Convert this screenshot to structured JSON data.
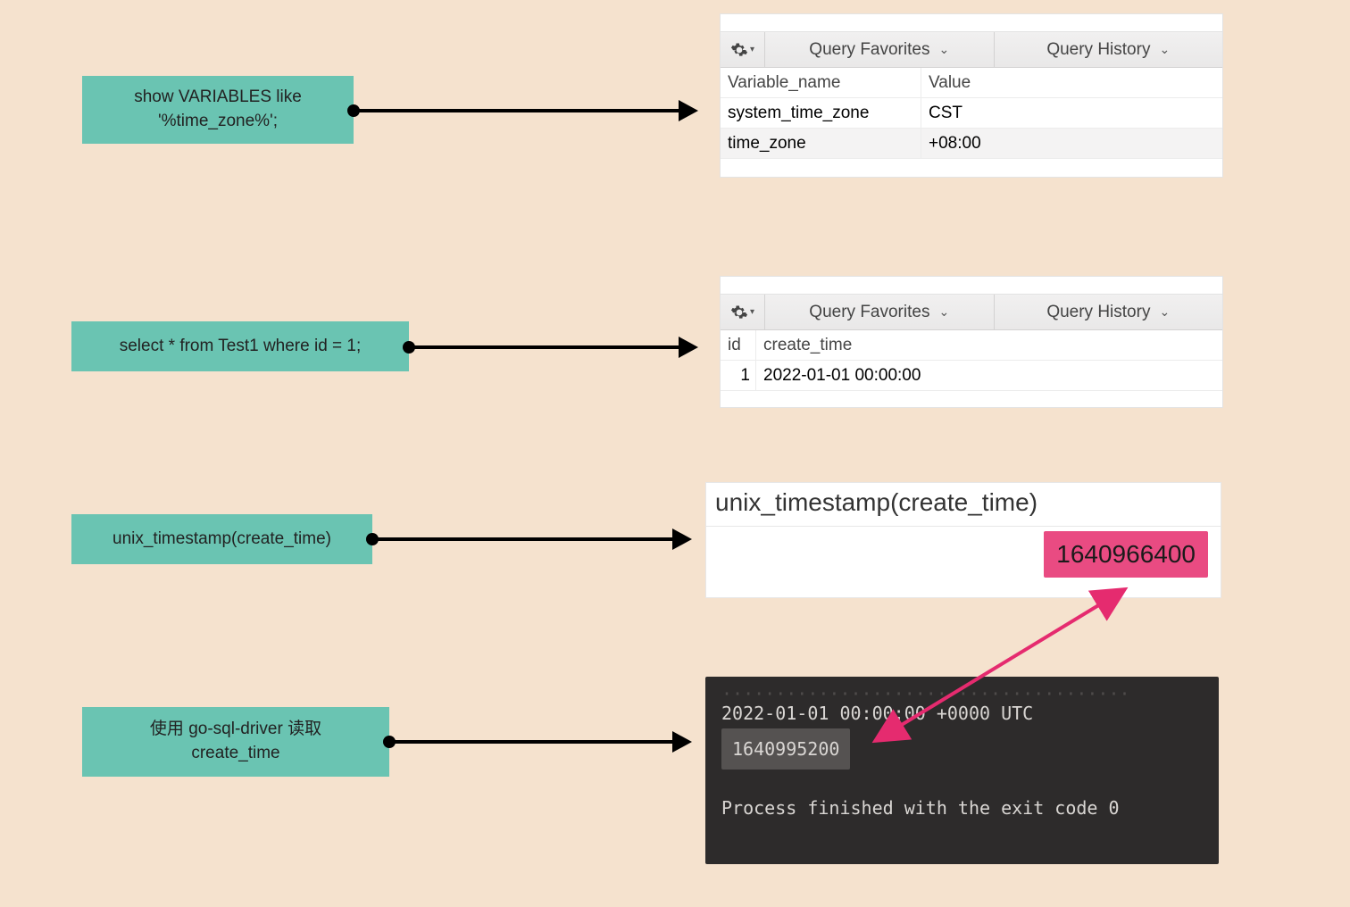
{
  "labels": {
    "l1_line1": "show VARIABLES like",
    "l1_line2": "'%time_zone%';",
    "l2": "select * from Test1 where id = 1;",
    "l3": "unix_timestamp(create_time)",
    "l4_line1": "使用 go-sql-driver 读取",
    "l4_line2": "create_time"
  },
  "toolbar": {
    "favorites": "Query Favorites",
    "history": "Query History"
  },
  "panel1": {
    "header_col1": "Variable_name",
    "header_col2": "Value",
    "row1_col1": "system_time_zone",
    "row1_col2": "CST",
    "row2_col1": "time_zone",
    "row2_col2": "+08:00"
  },
  "panel2": {
    "header_col1": "id",
    "header_col2": "create_time",
    "row1_col1": "1",
    "row1_col2": "2022-01-01 00:00:00"
  },
  "panel3": {
    "header": "unix_timestamp(create_time)",
    "value": "1640966400"
  },
  "terminal": {
    "line1": "2022-01-01 00:00:00 +0000 UTC",
    "line2": "1640995200",
    "line3": "Process finished with the exit code 0"
  },
  "colors": {
    "label_bg": "#6ac4b2",
    "page_bg": "#f5e2ce",
    "highlight_pink": "#e94b82",
    "terminal_bg": "#2d2b2b"
  }
}
